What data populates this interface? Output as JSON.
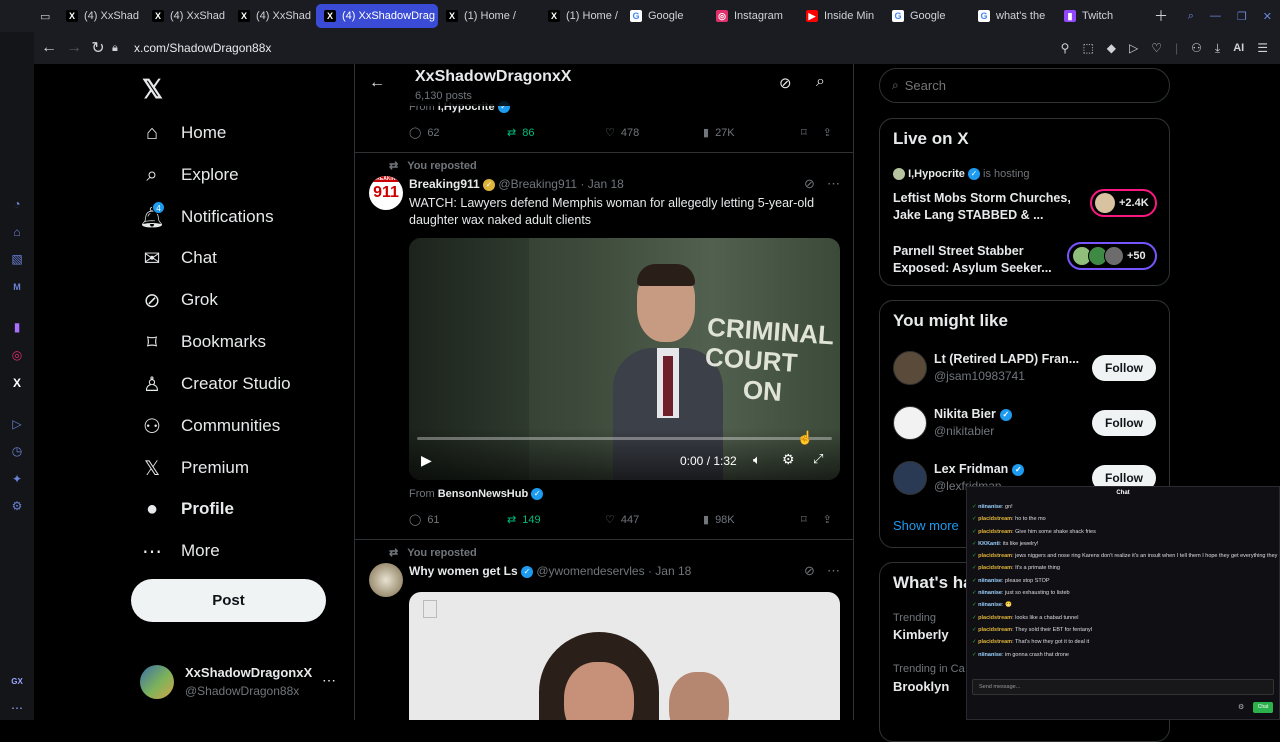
{
  "browser": {
    "tabs": [
      {
        "label": "(4) XxShad",
        "icon": "x-icon"
      },
      {
        "label": "(4) XxShad",
        "icon": "x-icon"
      },
      {
        "label": "(4) XxShad",
        "icon": "x-icon"
      },
      {
        "label": "(4) XxShadowDrag",
        "icon": "x-icon",
        "active": true
      },
      {
        "label": "(1) Home /",
        "icon": "x-icon"
      },
      {
        "label": "(1) Home /",
        "icon": "x-icon"
      },
      {
        "label": "Google",
        "icon": "google-icon"
      },
      {
        "label": "Instagram",
        "icon": "instagram-icon"
      },
      {
        "label": "Inside Min",
        "icon": "youtube-icon"
      },
      {
        "label": "Google",
        "icon": "google-icon"
      },
      {
        "label": "what's the",
        "icon": "google-icon"
      },
      {
        "label": "Twitch",
        "icon": "twitch-icon"
      }
    ],
    "url": "x.com/ShadowDragon88x",
    "ai_label": "AI"
  },
  "nav": {
    "items": [
      {
        "label": "Home",
        "icon": "home-icon"
      },
      {
        "label": "Explore",
        "icon": "search-icon"
      },
      {
        "label": "Notifications",
        "icon": "bell-icon",
        "badge": "4"
      },
      {
        "label": "Chat",
        "icon": "mail-icon"
      },
      {
        "label": "Grok",
        "icon": "grok-icon"
      },
      {
        "label": "Bookmarks",
        "icon": "bookmark-icon"
      },
      {
        "label": "Creator Studio",
        "icon": "creator-icon"
      },
      {
        "label": "Communities",
        "icon": "communities-icon"
      },
      {
        "label": "Premium",
        "icon": "x-icon"
      },
      {
        "label": "Profile",
        "icon": "person-icon"
      },
      {
        "label": "More",
        "icon": "more-icon"
      }
    ],
    "post_label": "Post",
    "account_name": "XxShadowDragonxX",
    "account_handle": "@ShadowDragon88x"
  },
  "header": {
    "title": "XxShadowDragonxX",
    "post_count": "6,130 posts"
  },
  "prev_post": {
    "from": "From",
    "from_name": "I,Hypocrite",
    "replies": "62",
    "reposts": "86",
    "likes": "478",
    "views": "27K"
  },
  "post1": {
    "repost_label": "You reposted",
    "author": "Breaking911",
    "handle": "@Breaking911",
    "date": "· Jan 18",
    "text": "WATCH: Lawyers defend Memphis woman for allegedly letting 5-year-old daughter wax naked adult clients",
    "video_time": "0:00 / 1:32",
    "video_sign_line1": "CRIMINAL",
    "video_sign_line2": "COURT",
    "video_sign_line3": "ON",
    "avatar_text": "911",
    "avatar_top": "BREAKING",
    "from": "From",
    "from_name": "BensonNewsHub",
    "replies": "61",
    "reposts": "149",
    "likes": "447",
    "views": "98K",
    "video_progress": 0.0
  },
  "post2": {
    "repost_label": "You reposted",
    "author": "Why women get Ls",
    "handle": "@ywomendeservles",
    "date": "· Jan 18"
  },
  "search": {
    "placeholder": "Search"
  },
  "live": {
    "title": "Live on X",
    "host": "I,Hypocrite",
    "host_suffix": "is hosting",
    "items": [
      {
        "title": "Leftist Mobs Storm Churches, Jake Lang STABBED & ...",
        "count": "+2.4K"
      },
      {
        "title": "Parnell Street Stabber Exposed: Asylum Seeker...",
        "count": "+50"
      }
    ]
  },
  "wtf": {
    "title": "You might like",
    "users": [
      {
        "name": "Lt (Retired LAPD) Fran...",
        "handle": "@jsam10983741",
        "button": "Follow"
      },
      {
        "name": "Nikita Bier",
        "handle": "@nikitabier",
        "button": "Follow"
      },
      {
        "name": "Lex Fridman",
        "handle": "@lexfridman",
        "button": "Follow"
      }
    ],
    "show_more": "Show more"
  },
  "trends": {
    "title": "What's ha",
    "items": [
      {
        "context": "Trending",
        "name": "Kimberly"
      },
      {
        "context": "Trending in Ca",
        "name": "Brooklyn"
      }
    ]
  },
  "chat": {
    "title": "Chat",
    "messages": [
      {
        "user": "niinanise",
        "text": "gn!"
      },
      {
        "user": "placidstream",
        "text": "ho to the mo"
      },
      {
        "user": "placidstream",
        "text": "Give him some shake shack fries"
      },
      {
        "user": "KKKanti",
        "text": "its like jewelry!"
      },
      {
        "user": "placidstream",
        "text": "jews niggers and nose ring Karens don't realize it's an insult when I tell them I hope they get everything they want."
      },
      {
        "user": "placidstream",
        "text": "It's a primate thing"
      },
      {
        "user": "niinanise",
        "text": "please stop STOP"
      },
      {
        "user": "niinanise",
        "text": "just so exhausting to listeb"
      },
      {
        "user": "niinanise",
        "text": "😬"
      },
      {
        "user": "placidstream",
        "text": "looks like a chabad tunnel"
      },
      {
        "user": "placidstream",
        "text": "They sold their EBT for fentanyl"
      },
      {
        "user": "placidstream",
        "text": "That's how they got it to deal it"
      },
      {
        "user": "niinanise",
        "text": "im gonna crash that drone"
      }
    ],
    "input_placeholder": "Send message...",
    "send_label": "Chat"
  },
  "colors": {
    "accent": "#1d9bf0",
    "repost_green": "#00ba7c",
    "tab_active": "#3a4bd6",
    "live_pink": "#f91880",
    "live_purple": "#7856ff"
  }
}
